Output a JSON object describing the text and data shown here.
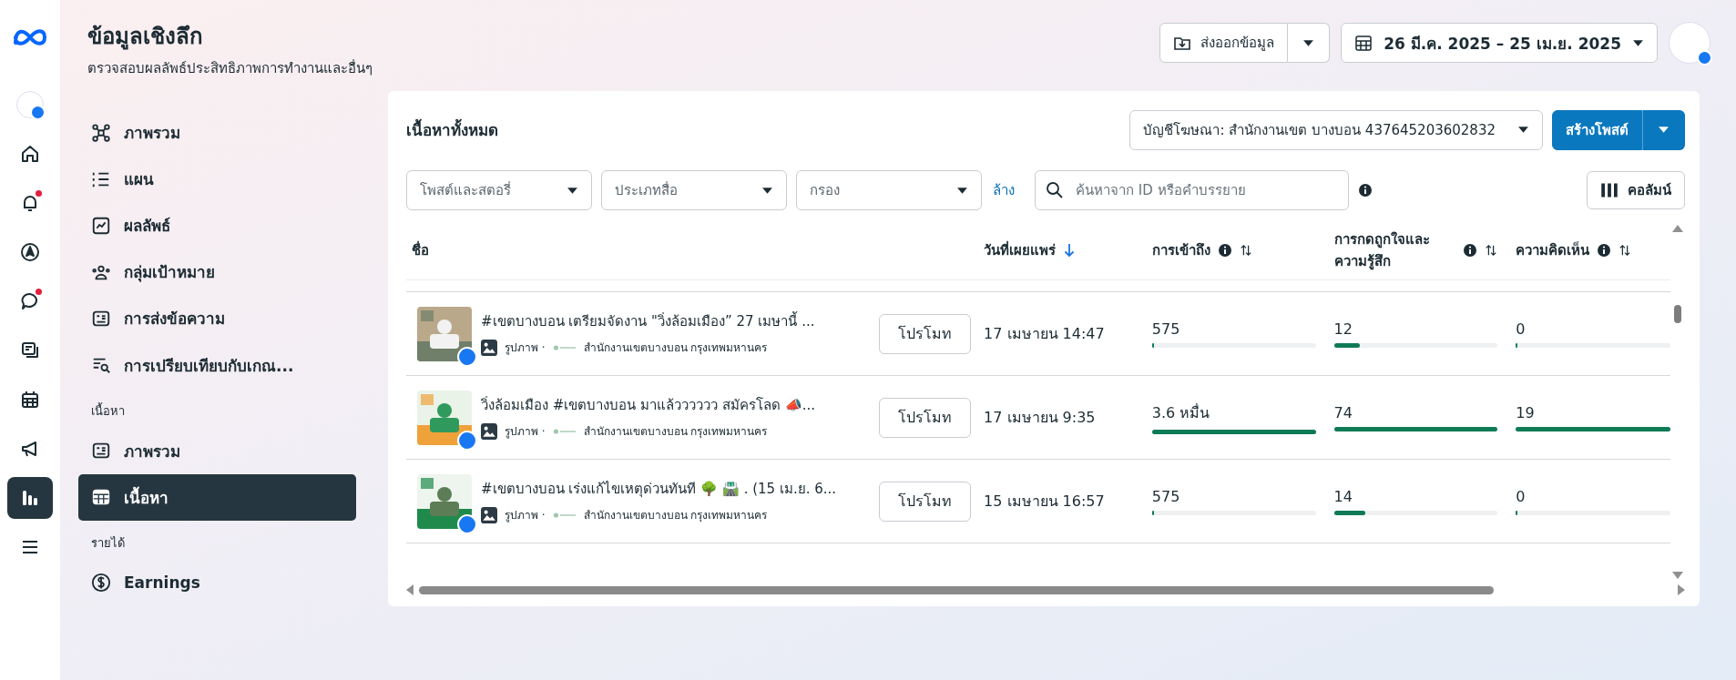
{
  "rail": [
    {
      "kind": "avatar",
      "badge": false,
      "selected": false
    },
    {
      "kind": "home",
      "badge": false,
      "selected": false
    },
    {
      "kind": "bell",
      "badge": true,
      "selected": false
    },
    {
      "kind": "compass",
      "badge": false,
      "selected": false
    },
    {
      "kind": "chat",
      "badge": true,
      "selected": false
    },
    {
      "kind": "pages",
      "badge": false,
      "selected": false
    },
    {
      "kind": "calendar",
      "badge": false,
      "selected": false
    },
    {
      "kind": "megaphone",
      "badge": false,
      "selected": false
    },
    {
      "kind": "insights",
      "badge": false,
      "selected": true
    },
    {
      "kind": "menu",
      "badge": false,
      "selected": false
    }
  ],
  "header": {
    "title": "ข้อมูลเชิงลึก",
    "subtitle": "ตรวจสอบผลลัพธ์ประสิทธิภาพการทำงานและอื่นๆ",
    "export_button": "ส่งออกข้อมูล",
    "date_range": "26 มี.ค. 2025 – 25 เม.ย. 2025"
  },
  "sidebar": [
    {
      "items": [
        {
          "label": "ภาพรวม",
          "selected": false
        },
        {
          "label": "แผน",
          "selected": false
        },
        {
          "label": "ผลลัพธ์",
          "selected": false
        },
        {
          "label": "กลุ่มเป้าหมาย",
          "selected": false
        },
        {
          "label": "การส่งข้อความ",
          "selected": false
        },
        {
          "label": "การเปรียบเทียบกับเกณ...",
          "selected": false
        }
      ]
    },
    {
      "heading": "เนื้อหา",
      "items": [
        {
          "label": "ภาพรวม",
          "selected": false
        },
        {
          "label": "เนื้อหา",
          "selected": true
        }
      ]
    },
    {
      "heading": "รายได้",
      "items": [
        {
          "label": "Earnings",
          "selected": false
        }
      ]
    }
  ],
  "content": {
    "title": "เนื้อหาทั้งหมด",
    "ad_account": "บัญชีโฆษณา: สำนักงานเขต บางบอน 437645203602832",
    "create_button": "สร้างโพสต์",
    "filters": [
      {
        "placeholder": "โพสต์และสตอรี่"
      },
      {
        "placeholder": "ประเภทสื่อ"
      },
      {
        "placeholder": "กรอง"
      }
    ],
    "clear_link": "ล้าง",
    "search": {
      "placeholder": "ค้นหาจาก ID หรือคำบรรยาย"
    },
    "columns_button": "คอลัมน์",
    "table": {
      "columns": [
        {
          "label": "ชื่อ",
          "kind": "plain"
        },
        {
          "label": "วันที่เผยแพร่",
          "kind": "sorted"
        },
        {
          "label": "การเข้าถึง",
          "kind": "metric"
        },
        {
          "label": "การกดถูกใจและความรู้สึก",
          "kind": "metric"
        },
        {
          "label": "ความคิดเห็น",
          "kind": "metric"
        }
      ],
      "rows": [
        {
          "title": "#เขตบางบอน เตรียมจัดงาน \"วิ่งล้อมเมือง” 27 เมษานี้ ...",
          "type": "รูปภาพ ·",
          "page": "สำนักงานเขตบางบอน กรุงเทพมหานคร",
          "promote": "โปรโมท",
          "date": "17 เมษายน 14:47",
          "metrics": [
            {
              "value": "575",
              "level": 0.01
            },
            {
              "value": "12",
              "level": 0.16
            },
            {
              "value": "0",
              "level": 0
            }
          ]
        },
        {
          "title": "วิ่งล้อมเมือง #เขตบางบอน มาแล้วววววว สมัครโลด 📣...",
          "type": "รูปภาพ ·",
          "page": "สำนักงานเขตบางบอน กรุงเทพมหานคร",
          "promote": "โปรโมท",
          "date": "17 เมษายน 9:35",
          "metrics": [
            {
              "value": "3.6 หมื่น",
              "level": 1
            },
            {
              "value": "74",
              "level": 1
            },
            {
              "value": "19",
              "level": 1
            }
          ]
        },
        {
          "title": "#เขตบางบอน เร่งแก้ไขเหตุด่วนทันที 🌳 🛣️ . (15 เม.ย. 6...",
          "type": "รูปภาพ ·",
          "page": "สำนักงานเขตบางบอน กรุงเทพมหานคร",
          "promote": "โปรโมท",
          "date": "15 เมษายน 16:57",
          "metrics": [
            {
              "value": "575",
              "level": 0.01
            },
            {
              "value": "14",
              "level": 0.19
            },
            {
              "value": "0",
              "level": 0
            }
          ]
        }
      ]
    }
  }
}
